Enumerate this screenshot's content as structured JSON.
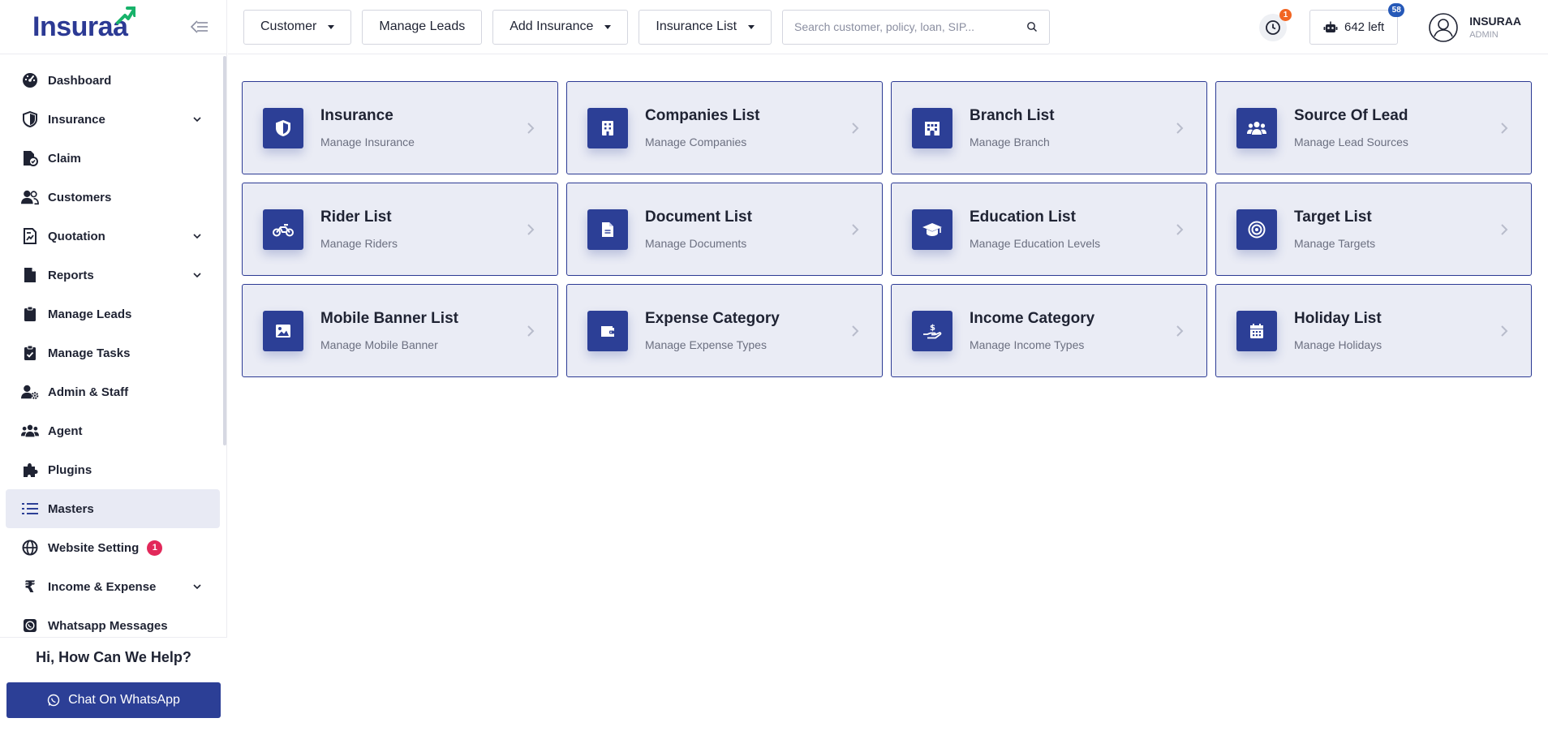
{
  "brand": {
    "logo_text": "Insuraa",
    "accent": "#2c3f96",
    "logo_accent": "#17b26a"
  },
  "sidebar": {
    "items": [
      {
        "label": "Dashboard",
        "icon": "dashboard-gauge-icon"
      },
      {
        "label": "Insurance",
        "icon": "shield-icon",
        "expandable": true
      },
      {
        "label": "Claim",
        "icon": "claim-document-icon"
      },
      {
        "label": "Customers",
        "icon": "users-icon"
      },
      {
        "label": "Quotation",
        "icon": "quotation-icon",
        "expandable": true
      },
      {
        "label": "Reports",
        "icon": "report-file-icon",
        "expandable": true
      },
      {
        "label": "Manage Leads",
        "icon": "clipboard-icon"
      },
      {
        "label": "Manage Tasks",
        "icon": "clipboard-check-icon"
      },
      {
        "label": "Admin & Staff",
        "icon": "user-gear-icon"
      },
      {
        "label": "Agent",
        "icon": "group-icon"
      },
      {
        "label": "Plugins",
        "icon": "puzzle-icon"
      },
      {
        "label": "Masters",
        "icon": "list-icon",
        "active": true
      },
      {
        "label": "Website Setting",
        "icon": "globe-icon",
        "badge": "1"
      },
      {
        "label": "Income & Expense",
        "icon": "rupee-icon",
        "expandable": true
      },
      {
        "label": "Whatsapp Messages",
        "icon": "whatsapp-icon"
      }
    ],
    "help_title": "Hi, How Can We Help?",
    "whatsapp_button": "Chat On WhatsApp"
  },
  "topbar": {
    "customer_label": "Customer",
    "manage_leads_label": "Manage Leads",
    "add_insurance_label": "Add Insurance",
    "insurance_list_label": "Insurance List",
    "search_placeholder": "Search customer, policy, loan, SIP...",
    "notification_count": "1",
    "credits_label": "642 left",
    "credits_badge": "58",
    "user_name": "INSURAA",
    "user_role": "ADMIN"
  },
  "cards": [
    {
      "title": "Insurance",
      "subtitle": "Manage Insurance",
      "icon": "shield-icon"
    },
    {
      "title": "Companies List",
      "subtitle": "Manage Companies",
      "icon": "building-icon"
    },
    {
      "title": "Branch List",
      "subtitle": "Manage Branch",
      "icon": "branch-building-icon"
    },
    {
      "title": "Source Of Lead",
      "subtitle": "Manage Lead Sources",
      "icon": "users-icon"
    },
    {
      "title": "Rider List",
      "subtitle": "Manage Riders",
      "icon": "motorcycle-icon"
    },
    {
      "title": "Document List",
      "subtitle": "Manage Documents",
      "icon": "document-icon"
    },
    {
      "title": "Education List",
      "subtitle": "Manage Education Levels",
      "icon": "graduation-cap-icon"
    },
    {
      "title": "Target List",
      "subtitle": "Manage Targets",
      "icon": "target-icon"
    },
    {
      "title": "Mobile Banner List",
      "subtitle": "Manage Mobile Banner",
      "icon": "image-icon"
    },
    {
      "title": "Expense Category",
      "subtitle": "Manage Expense Types",
      "icon": "wallet-icon"
    },
    {
      "title": "Income Category",
      "subtitle": "Manage Income Types",
      "icon": "hand-money-icon"
    },
    {
      "title": "Holiday List",
      "subtitle": "Manage Holidays",
      "icon": "calendar-icon"
    }
  ]
}
